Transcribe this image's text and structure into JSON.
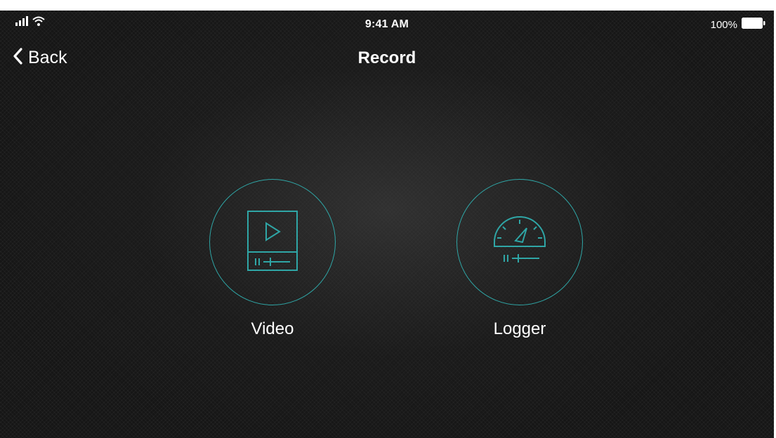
{
  "status_bar": {
    "time": "9:41 AM",
    "battery_percent": "100%",
    "signal_icon": "cellular-signal-icon",
    "wifi_icon": "wifi-icon",
    "battery_icon": "battery-icon"
  },
  "nav": {
    "back_label": "Back",
    "back_icon": "chevron-left-icon",
    "title": "Record"
  },
  "options": [
    {
      "label": "Video",
      "icon": "video-player-icon"
    },
    {
      "label": "Logger",
      "icon": "speedometer-icon"
    }
  ],
  "colors": {
    "accent": "#2fa6a6",
    "text": "#ffffff",
    "background": "#161616"
  }
}
